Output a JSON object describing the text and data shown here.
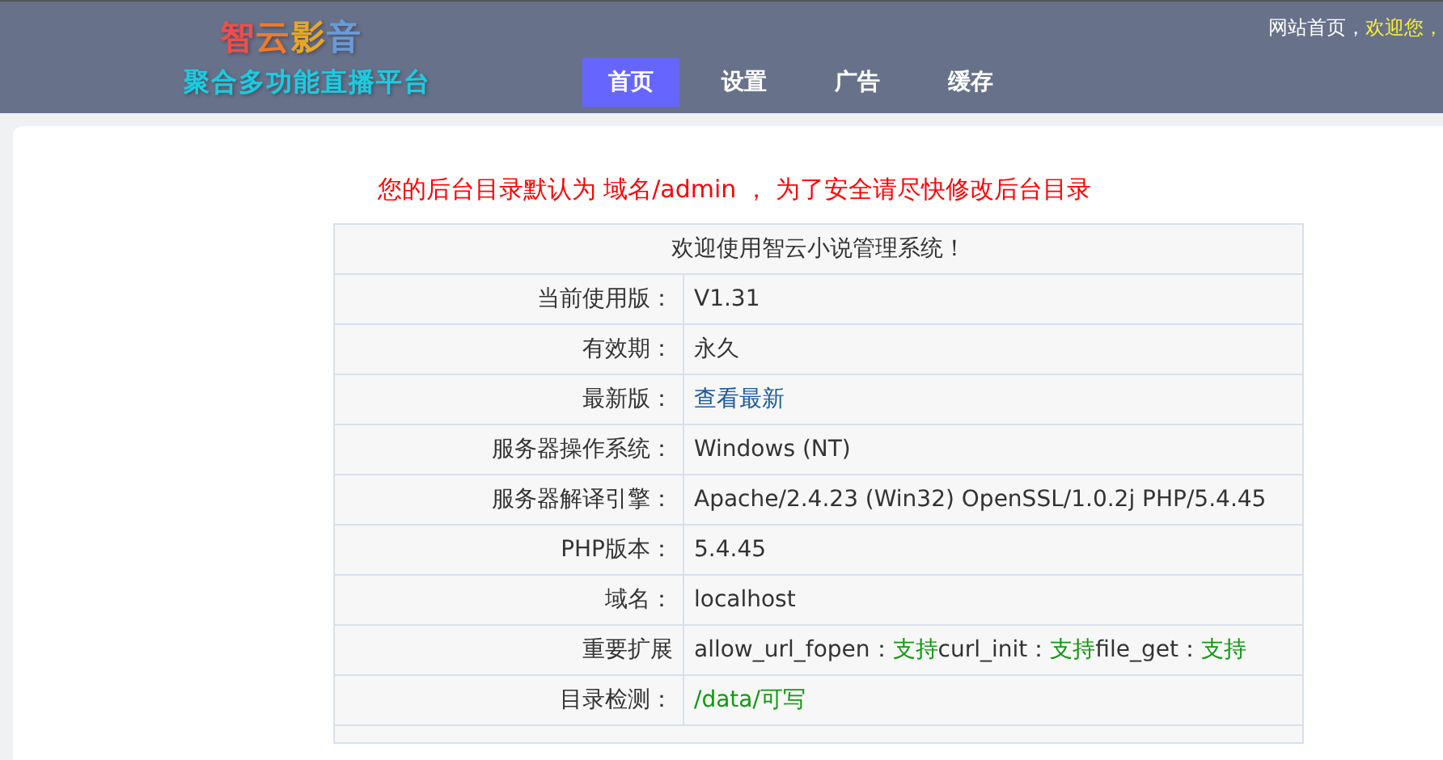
{
  "header": {
    "logo_title": [
      {
        "text": "智",
        "color": "#ee4e4a"
      },
      {
        "text": "云",
        "color": "#f07a2a"
      },
      {
        "text": "影",
        "color": "#e8a628"
      },
      {
        "text": "音",
        "color": "#6a9ad8"
      }
    ],
    "logo_subtitle": "聚合多功能直播平台",
    "nav": [
      {
        "label": "首页",
        "selected": true
      },
      {
        "label": "设置",
        "selected": false
      },
      {
        "label": "广告",
        "selected": false
      },
      {
        "label": "缓存",
        "selected": false
      }
    ],
    "top_links": [
      {
        "text": "网站首页，",
        "kind": "link"
      },
      {
        "text": "欢迎您，",
        "kind": "welcome"
      }
    ]
  },
  "notice": "您的后台目录默认为 域名/admin ， 为了安全请尽快修改后台目录",
  "table": {
    "title": "欢迎使用智云小说管理系统！",
    "rows": [
      {
        "label": "当前使用版：",
        "value": [
          {
            "text": "V1.31",
            "kind": "plain"
          }
        ]
      },
      {
        "label": "有效期：",
        "value": [
          {
            "text": "永久",
            "kind": "plain"
          }
        ]
      },
      {
        "label": "最新版：",
        "value": [
          {
            "text": "查看最新",
            "kind": "link"
          }
        ]
      },
      {
        "label": "服务器操作系统：",
        "value": [
          {
            "text": "Windows (NT)",
            "kind": "plain"
          }
        ]
      },
      {
        "label": "服务器解译引擎：",
        "value": [
          {
            "text": "Apache/2.4.23 (Win32) OpenSSL/1.0.2j PHP/5.4.45",
            "kind": "plain"
          }
        ]
      },
      {
        "label": "PHP版本：",
        "value": [
          {
            "text": "5.4.45",
            "kind": "plain"
          }
        ]
      },
      {
        "label": "域名：",
        "value": [
          {
            "text": "localhost",
            "kind": "plain"
          }
        ]
      },
      {
        "label": "重要扩展",
        "value": [
          {
            "text": "allow_url_fopen：",
            "kind": "plain"
          },
          {
            "text": "支持",
            "kind": "ok"
          },
          {
            "text": "curl_init：",
            "kind": "plain"
          },
          {
            "text": "支持",
            "kind": "ok"
          },
          {
            "text": "file_get：",
            "kind": "plain"
          },
          {
            "text": "支持",
            "kind": "ok"
          }
        ]
      },
      {
        "label": "目录检测：",
        "value": [
          {
            "text": "/data/可写",
            "kind": "ok"
          }
        ]
      }
    ]
  }
}
